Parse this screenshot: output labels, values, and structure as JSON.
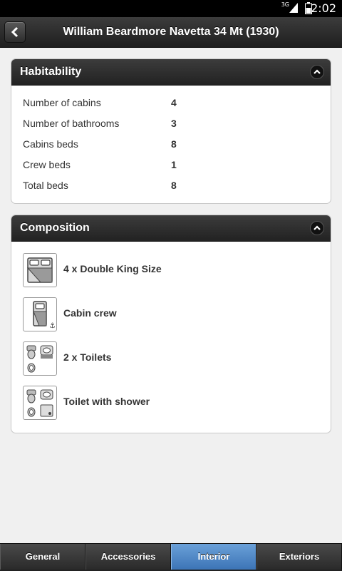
{
  "status_bar": {
    "time": "2:02",
    "network": "3G"
  },
  "header": {
    "title": "William Beardmore Navetta 34 Mt (1930)"
  },
  "habitability": {
    "title": "Habitability",
    "rows": [
      {
        "label": "Number of cabins",
        "value": "4"
      },
      {
        "label": "Number of bathrooms",
        "value": "3"
      },
      {
        "label": "Cabins beds",
        "value": "8"
      },
      {
        "label": "Crew beds",
        "value": "1"
      },
      {
        "label": "Total beds",
        "value": "8"
      }
    ]
  },
  "composition": {
    "title": "Composition",
    "items": [
      {
        "label": "4 x Double King Size",
        "icon": "double-bed-icon"
      },
      {
        "label": "Cabin crew",
        "icon": "crew-bed-icon"
      },
      {
        "label": "2 x Toilets",
        "icon": "toilet-icon"
      },
      {
        "label": "Toilet with shower",
        "icon": "toilet-shower-icon"
      }
    ]
  },
  "tabs": [
    {
      "label": "General",
      "active": false
    },
    {
      "label": "Accessories",
      "active": false
    },
    {
      "label": "Interior",
      "active": true
    },
    {
      "label": "Exteriors",
      "active": false
    }
  ],
  "colors": {
    "active_tab": "#4a84c4",
    "header_bg": "#2a2a2a",
    "page_bg": "#f0f0f0"
  }
}
